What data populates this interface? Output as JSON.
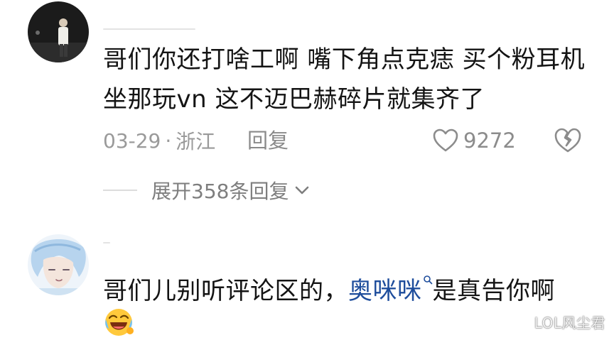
{
  "comments": [
    {
      "text": "哥们你还打啥工啊 嘴下角点克痣 买个粉耳机 坐那玩vn 这不迈巴赫碎片就集齐了",
      "date": "03-29",
      "separator": "·",
      "location": "浙江",
      "reply_label": "回复",
      "like_count": "9272",
      "expand_label": "展开358条回复"
    },
    {
      "text_before": "哥们儿别听评论区的，",
      "mention": "奥咪咪",
      "text_after": "是真告你啊"
    }
  ],
  "watermark": "LOL风尘君",
  "colors": {
    "text": "#141414",
    "meta": "#9a9a9a",
    "mention": "#1e4d9c"
  }
}
